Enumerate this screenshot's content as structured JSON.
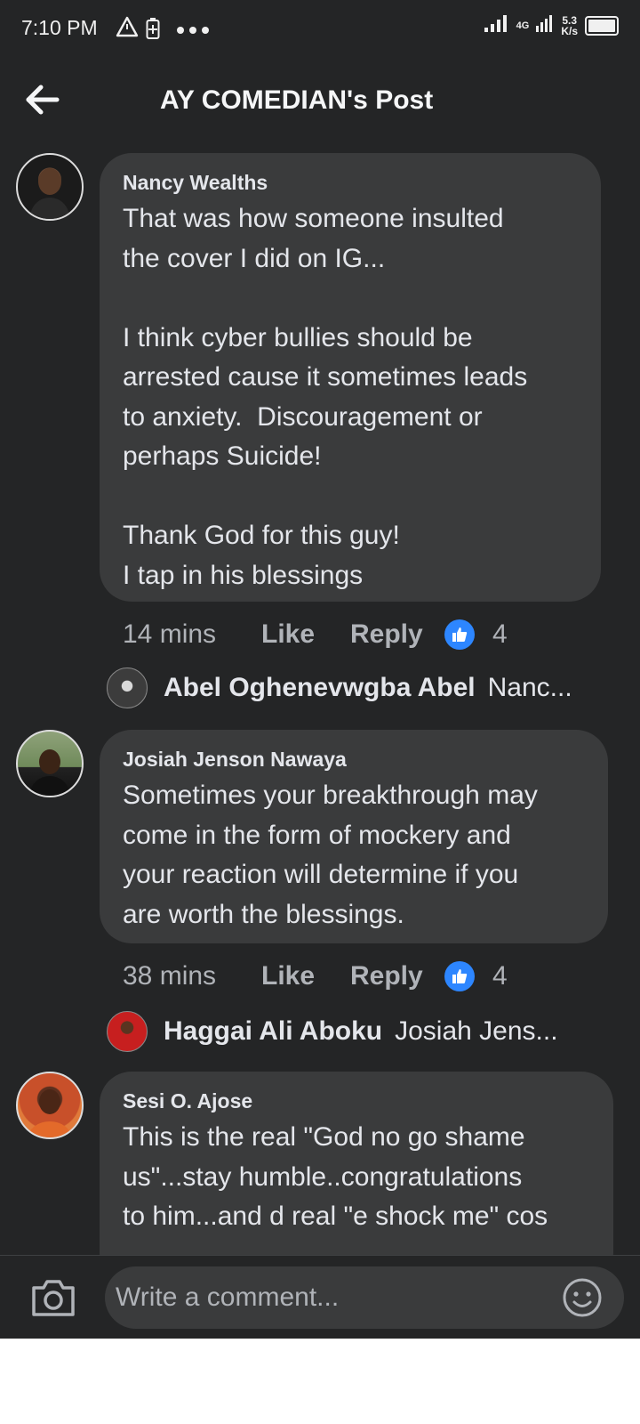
{
  "status_bar": {
    "time": "7:10 PM",
    "net_type": "4G",
    "speed_value": "5.3",
    "speed_unit": "K/s",
    "icons": [
      "warning-icon",
      "battery-saver-icon",
      "more-dots-icon",
      "signal-icon",
      "battery-icon"
    ]
  },
  "header": {
    "title": "AY COMEDIAN's Post"
  },
  "comments": [
    {
      "author": "Nancy Wealths",
      "text": "That was how someone insulted\nthe cover I did on IG...\n\nI think cyber bullies should be\narrested cause it sometimes leads\nto anxiety.  Discouragement or\nperhaps Suicide!\n\nThank God for this guy!\nI tap in his blessings",
      "time": "14 mins",
      "like_label": "Like",
      "reply_label": "Reply",
      "reaction_count": "4",
      "reply": {
        "author": "Abel Oghenevwgba Abel",
        "preview": "Nanc..."
      }
    },
    {
      "author": "Josiah Jenson Nawaya",
      "text": "Sometimes your breakthrough may\ncome in the form of mockery and\nyour reaction will determine if you\nare worth the blessings.",
      "time": "38 mins",
      "like_label": "Like",
      "reply_label": "Reply",
      "reaction_count": "4",
      "reply": {
        "author": "Haggai Ali Aboku",
        "preview": "Josiah Jens..."
      }
    },
    {
      "author": "Sesi O. Ajose",
      "text": "This is the real \"God no go shame\nus\"...stay humble..congratulations\nto him...and d real \"e shock me\" cos"
    }
  ],
  "composer": {
    "placeholder": "Write a comment..."
  },
  "colors": {
    "background": "#242526",
    "bubble": "#3a3b3c",
    "text": "#e4e6eb",
    "meta_text": "#b0b3b8",
    "like_reaction": "#2d86ff"
  }
}
